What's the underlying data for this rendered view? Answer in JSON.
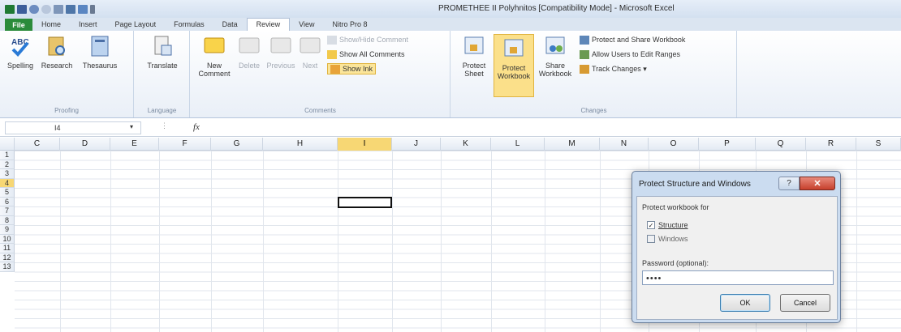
{
  "window": {
    "title": "PROMETHEE II Polyhnitos  [Compatibility Mode]  -  Microsoft Excel"
  },
  "tabs": {
    "file": "File",
    "items": [
      "Home",
      "Insert",
      "Page Layout",
      "Formulas",
      "Data",
      "Review",
      "View",
      "Nitro Pro 8"
    ],
    "active": "Review"
  },
  "ribbon": {
    "proofing": {
      "label": "Proofing",
      "spelling": "Spelling",
      "research": "Research",
      "thesaurus": "Thesaurus"
    },
    "language": {
      "label": "Language",
      "translate": "Translate"
    },
    "comments": {
      "label": "Comments",
      "new": "New\nComment",
      "delete": "Delete",
      "previous": "Previous",
      "next": "Next",
      "show_hide": "Show/Hide Comment",
      "show_all": "Show All Comments",
      "show_ink": "Show Ink"
    },
    "changes": {
      "label": "Changes",
      "protect_sheet": "Protect\nSheet",
      "protect_workbook": "Protect\nWorkbook",
      "share_workbook": "Share\nWorkbook",
      "protect_share": "Protect and Share Workbook",
      "allow_users": "Allow Users to Edit Ranges",
      "track_changes": "Track Changes ▾"
    }
  },
  "formula_bar": {
    "name_box": "I4",
    "fx": "fx",
    "value": ""
  },
  "grid": {
    "columns": [
      "C",
      "D",
      "E",
      "F",
      "G",
      "H",
      "I",
      "J",
      "K",
      "L",
      "M",
      "N",
      "O",
      "P",
      "Q",
      "R",
      "S"
    ],
    "rows": [
      "1",
      "2",
      "3",
      "4",
      "5",
      "6",
      "7",
      "8",
      "9",
      "10",
      "11",
      "12",
      "13"
    ],
    "selected_column": "I",
    "selected_row": "4"
  },
  "dialog": {
    "title": "Protect Structure and Windows",
    "help": "?",
    "close": "✕",
    "group_label": "Protect workbook for",
    "structure_label": "Structure",
    "structure_checked": true,
    "windows_label": "Windows",
    "windows_checked": false,
    "password_label": "Password (optional):",
    "password_value": "••••",
    "ok_label": "OK",
    "cancel_label": "Cancel"
  },
  "colors": {
    "file_tab": "#2a8b3b",
    "selection_header": "#f7d774",
    "ribbon_bg": "#e9eff7"
  }
}
